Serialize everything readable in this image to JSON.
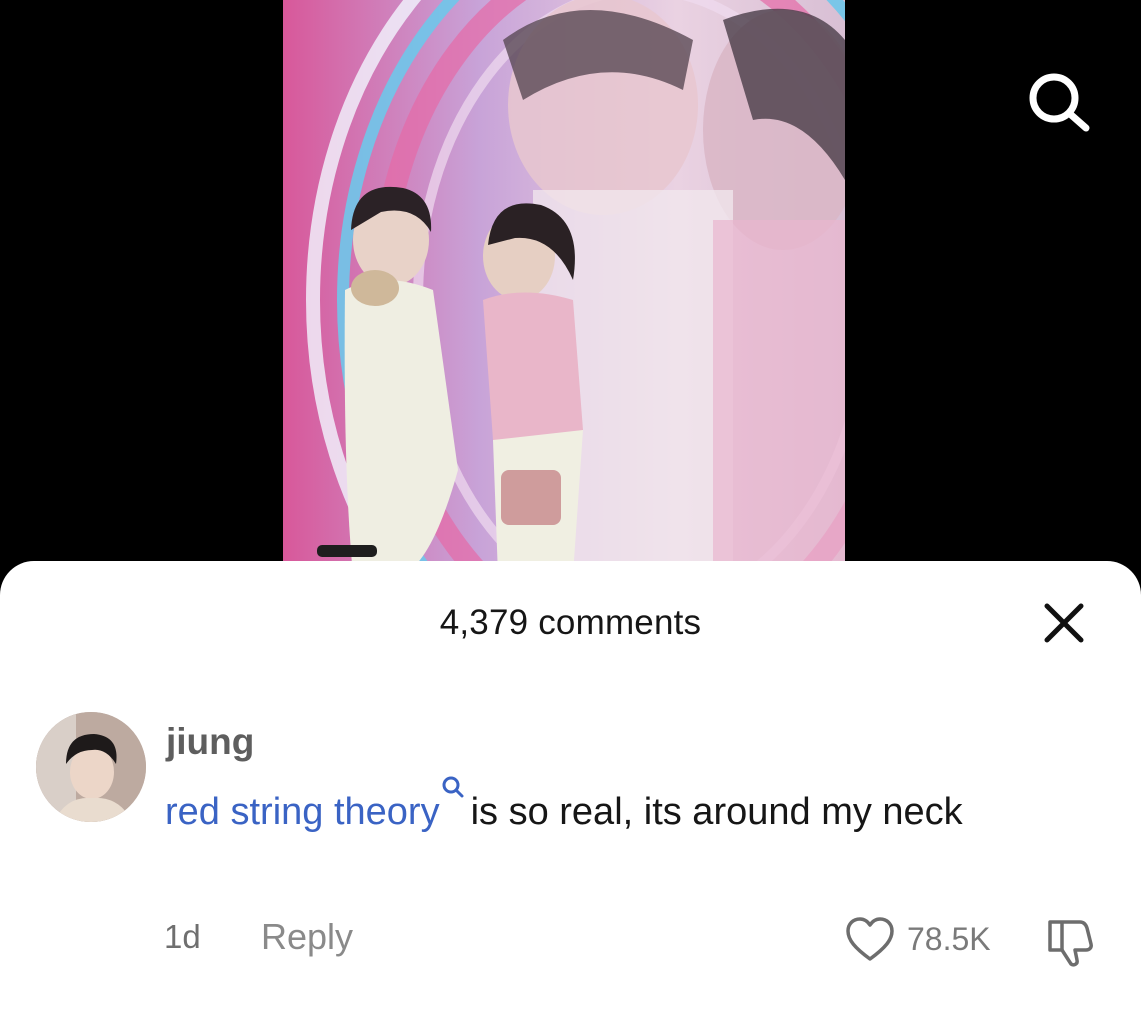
{
  "player": {
    "search_icon": "search-icon"
  },
  "comments_sheet": {
    "title": "4,379 comments",
    "close_icon": "close-icon"
  },
  "comment": {
    "username": "jiung",
    "search_tag": "red string theory",
    "search_tag_icon": "search-icon",
    "text": "is so real, its around my neck",
    "age": "1d",
    "reply_label": "Reply",
    "like_icon": "heart-icon",
    "like_count": "78.5K",
    "dislike_icon": "thumbs-down-icon"
  },
  "colors": {
    "background": "#000000",
    "sheet": "#ffffff",
    "link": "#3a63c4",
    "muted_text": "#8a8a8a"
  }
}
